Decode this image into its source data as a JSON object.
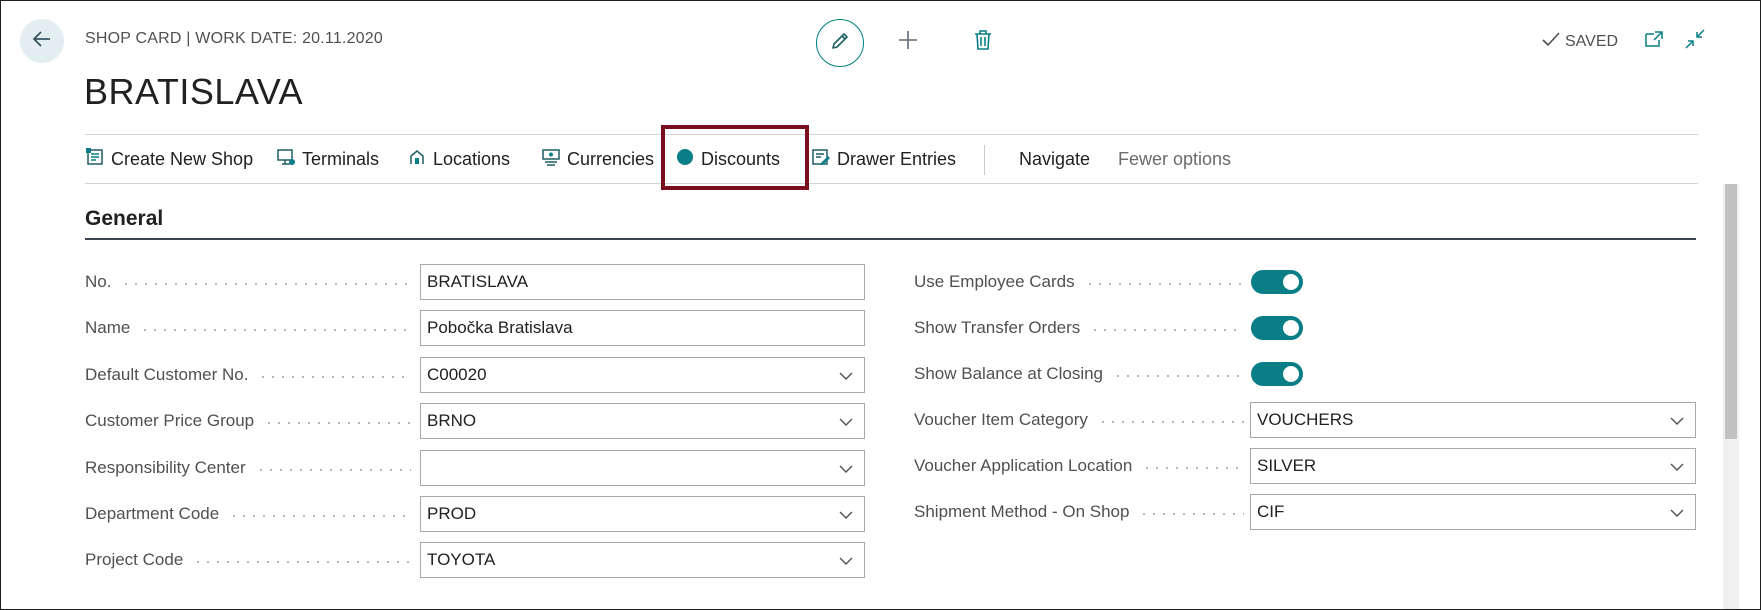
{
  "header": {
    "caption": "SHOP CARD | WORK DATE: 20.11.2020",
    "title": "BRATISLAVA",
    "saved_label": "SAVED"
  },
  "actions": [
    {
      "label": "Create New Shop",
      "icon": "create-shop-icon"
    },
    {
      "label": "Terminals",
      "icon": "terminal-icon"
    },
    {
      "label": "Locations",
      "icon": "locations-icon"
    },
    {
      "label": "Currencies",
      "icon": "currencies-icon"
    },
    {
      "label": "Discounts",
      "icon": "discount-dot-icon"
    },
    {
      "label": "Drawer Entries",
      "icon": "drawer-entries-icon"
    },
    {
      "label": "Navigate"
    },
    {
      "label": "Fewer options"
    }
  ],
  "section": {
    "title": "General"
  },
  "left_fields": [
    {
      "label": "No.",
      "value": "BRATISLAVA",
      "type": "text"
    },
    {
      "label": "Name",
      "value": "Pobočka Bratislava",
      "type": "text"
    },
    {
      "label": "Default Customer No.",
      "value": "C00020",
      "type": "select"
    },
    {
      "label": "Customer Price Group",
      "value": "BRNO",
      "type": "select"
    },
    {
      "label": "Responsibility Center",
      "value": "",
      "type": "select"
    },
    {
      "label": "Department Code",
      "value": "PROD",
      "type": "select"
    },
    {
      "label": "Project Code",
      "value": "TOYOTA",
      "type": "select"
    }
  ],
  "right_fields": [
    {
      "label": "Use Employee Cards",
      "value": true,
      "type": "toggle"
    },
    {
      "label": "Show Transfer Orders",
      "value": true,
      "type": "toggle"
    },
    {
      "label": "Show Balance at Closing",
      "value": true,
      "type": "toggle"
    },
    {
      "label": "Voucher Item Category",
      "value": "VOUCHERS",
      "type": "select"
    },
    {
      "label": "Voucher Application Location",
      "value": "SILVER",
      "type": "select"
    },
    {
      "label": "Shipment Method - On Shop",
      "value": "CIF",
      "type": "select"
    }
  ],
  "colors": {
    "accent": "#0a7e86",
    "highlight": "#7a0d1e"
  }
}
